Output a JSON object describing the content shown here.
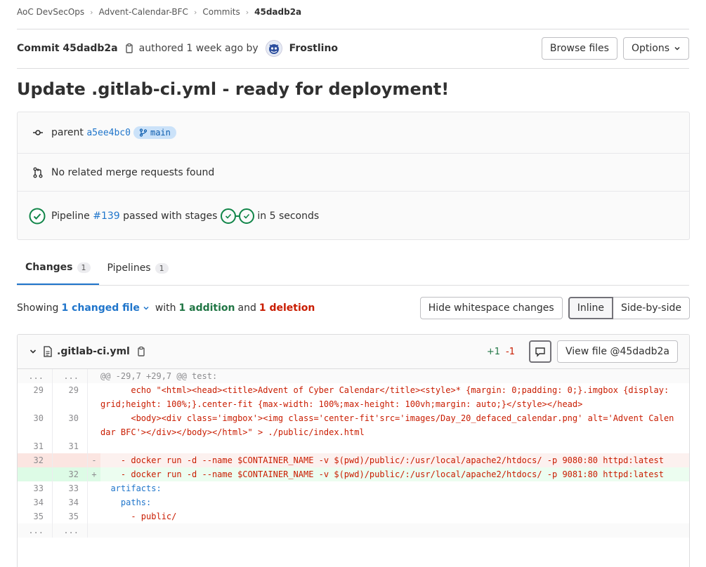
{
  "breadcrumb": [
    "AoC DevSecOps",
    "Advent-Calendar-BFC",
    "Commits",
    "45dadb2a"
  ],
  "commit": {
    "label": "Commit 45dadb2a",
    "authored": "authored 1 week ago by",
    "author": "Frostlino",
    "browse_files": "Browse files",
    "options": "Options"
  },
  "title": "Update .gitlab-ci.yml - ready for deployment!",
  "info": {
    "parent_label": "parent",
    "parent_sha": "a5ee4bc0",
    "branch": "main",
    "merge_requests": "No related merge requests found",
    "pipeline_prefix": "Pipeline",
    "pipeline_id": "#139",
    "pipeline_mid": "passed with stages",
    "pipeline_suffix": "in 5 seconds"
  },
  "tabs": [
    {
      "label": "Changes",
      "count": "1"
    },
    {
      "label": "Pipelines",
      "count": "1"
    }
  ],
  "summary": {
    "showing": "Showing",
    "changed": "1 changed file",
    "with": "with",
    "additions": "1 addition",
    "and": "and",
    "deletions": "1 deletion",
    "hide_ws": "Hide whitespace changes",
    "inline": "Inline",
    "side_by_side": "Side-by-side"
  },
  "file": {
    "name": ".gitlab-ci.yml",
    "plus": "+1",
    "minus": "-1",
    "view_file": "View file @45dadb2a"
  },
  "diff_lines": [
    {
      "type": "match",
      "old": "...",
      "new": "...",
      "sign": "",
      "text": "@@ -29,7 +29,7 @@ test:"
    },
    {
      "type": "ctx",
      "old": "29",
      "new": "29",
      "sign": "",
      "text": "      echo \"<html><head><title>Advent of Cyber Calendar</title><style>* {margin: 0;padding: 0;}.imgbox {display: grid;height: 100%;}.center-fit {max-width: 100%;max-height: 100vh;margin: auto;}</style></head>"
    },
    {
      "type": "ctx",
      "old": "30",
      "new": "30",
      "sign": "",
      "text": "      <body><div class='imgbox'><img class='center-fit'src='images/Day_20_defaced_calendar.png' alt='Advent Calendar BFC'></div></body></html>\" > ./public/index.html"
    },
    {
      "type": "ctx",
      "old": "31",
      "new": "31",
      "sign": "",
      "text": ""
    },
    {
      "type": "del",
      "old": "32",
      "new": "",
      "sign": "-",
      "text": "    - docker run -d --name $CONTAINER_NAME -v $(pwd)/public/:/usr/local/apache2/htdocs/ -p 9080:80 httpd:latest"
    },
    {
      "type": "add",
      "old": "",
      "new": "32",
      "sign": "+",
      "text": "    - docker run -d --name $CONTAINER_NAME -v $(pwd)/public/:/usr/local/apache2/htdocs/ -p 9081:80 httpd:latest"
    },
    {
      "type": "ctx",
      "old": "33",
      "new": "33",
      "sign": "",
      "text": "  artifacts:"
    },
    {
      "type": "ctx",
      "old": "34",
      "new": "34",
      "sign": "",
      "text": "    paths:"
    },
    {
      "type": "ctx",
      "old": "35",
      "new": "35",
      "sign": "",
      "text": "      - public/"
    },
    {
      "type": "match",
      "old": "...",
      "new": "...",
      "sign": "",
      "text": ""
    }
  ]
}
